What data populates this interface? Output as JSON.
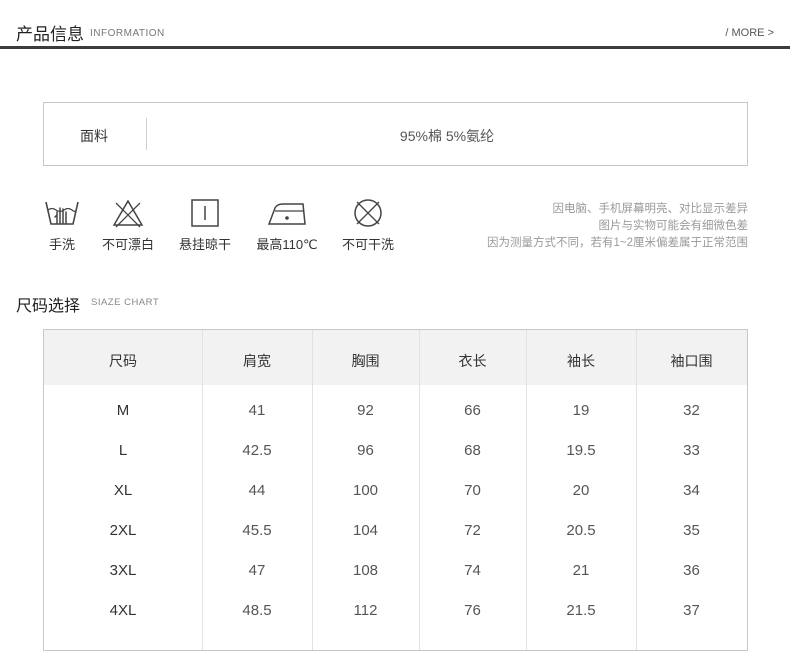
{
  "header": {
    "title": "产品信息",
    "subtitle": "INFORMATION",
    "more": "/  MORE >"
  },
  "fabric": {
    "label": "面料",
    "value": "95%棉    5%氨纶"
  },
  "care": [
    {
      "icon": "hand-wash-icon",
      "label": "手洗"
    },
    {
      "icon": "no-bleach-icon",
      "label": "不可漂白"
    },
    {
      "icon": "hang-dry-icon",
      "label": "悬挂晾干"
    },
    {
      "icon": "iron-icon",
      "label": "最高110℃"
    },
    {
      "icon": "no-dry-clean-icon",
      "label": "不可干洗"
    }
  ],
  "notice": [
    "因电脑、手机屏幕明亮、对比显示差异",
    "图片与实物可能会有细微色差",
    "因为测量方式不同，若有1~2厘米偏差属于正常范围"
  ],
  "size_chart": {
    "title": "尺码选择",
    "subtitle": "SIAZE CHART",
    "headers": [
      "尺码",
      "肩宽",
      "胸围",
      "衣长",
      "袖长",
      "袖口围"
    ],
    "rows": [
      [
        "M",
        "41",
        "92",
        "66",
        "19",
        "32"
      ],
      [
        "L",
        "42.5",
        "96",
        "68",
        "19.5",
        "33"
      ],
      [
        "XL",
        "44",
        "100",
        "70",
        "20",
        "34"
      ],
      [
        "2XL",
        "45.5",
        "104",
        "72",
        "20.5",
        "35"
      ],
      [
        "3XL",
        "47",
        "108",
        "74",
        "21",
        "36"
      ],
      [
        "4XL",
        "48.5",
        "112",
        "76",
        "21.5",
        "37"
      ]
    ]
  }
}
